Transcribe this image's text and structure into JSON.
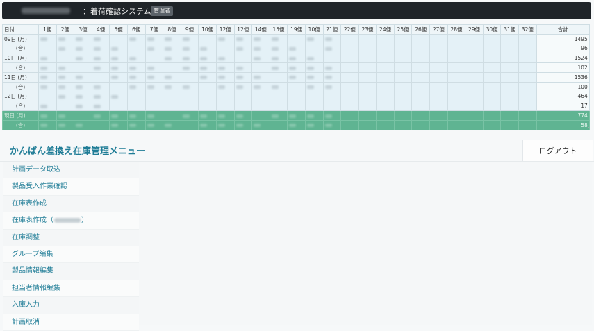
{
  "header": {
    "title": "：着荷確認システム",
    "role_badge": "管理者"
  },
  "table": {
    "columns": [
      "日付",
      "1便",
      "2便",
      "3便",
      "4便",
      "5便",
      "6便",
      "7便",
      "8便",
      "9便",
      "10便",
      "12便",
      "12便",
      "14便",
      "15便",
      "19便",
      "10便",
      "21便",
      "22便",
      "23便",
      "24便",
      "25便",
      "26便",
      "27便",
      "28便",
      "29便",
      "30便",
      "31便",
      "32便",
      "合計"
    ],
    "rows": [
      {
        "label": "09日 (月)",
        "total": "1495",
        "highlight": false,
        "filled": 17
      },
      {
        "label": "(合)",
        "total": "96",
        "highlight": false,
        "filled": 17
      },
      {
        "label": "10日 (月)",
        "total": "1524",
        "highlight": false,
        "filled": 17
      },
      {
        "label": "(合)",
        "total": "102",
        "highlight": false,
        "filled": 17
      },
      {
        "label": "11日 (月)",
        "total": "1536",
        "highlight": false,
        "filled": 17
      },
      {
        "label": "(合)",
        "total": "100",
        "highlight": false,
        "filled": 17
      },
      {
        "label": "12日 (月)",
        "total": "464",
        "highlight": false,
        "filled": 6
      },
      {
        "label": "(合)",
        "total": "17",
        "highlight": false,
        "filled": 4
      },
      {
        "label": "現日 (月)",
        "total": "774",
        "highlight": true,
        "filled": 17
      },
      {
        "label": "(合)",
        "total": "58",
        "highlight": true,
        "filled": 17
      }
    ]
  },
  "menu_title": "かんばん差換え在庫管理メニュー",
  "logout_label": "ログアウト",
  "menu": [
    {
      "label": "計画データ取込"
    },
    {
      "label": "製品受入作業確認"
    },
    {
      "label": "在庫表作成"
    },
    {
      "label": "在庫表作成（",
      "suffix": "）",
      "has_blur": true
    },
    {
      "label": "在庫調整"
    },
    {
      "label": "グループ編集"
    },
    {
      "label": "製品情報編集"
    },
    {
      "label": "担当者情報編集"
    },
    {
      "label": "入庫入力"
    },
    {
      "label": "計画取消"
    }
  ]
}
